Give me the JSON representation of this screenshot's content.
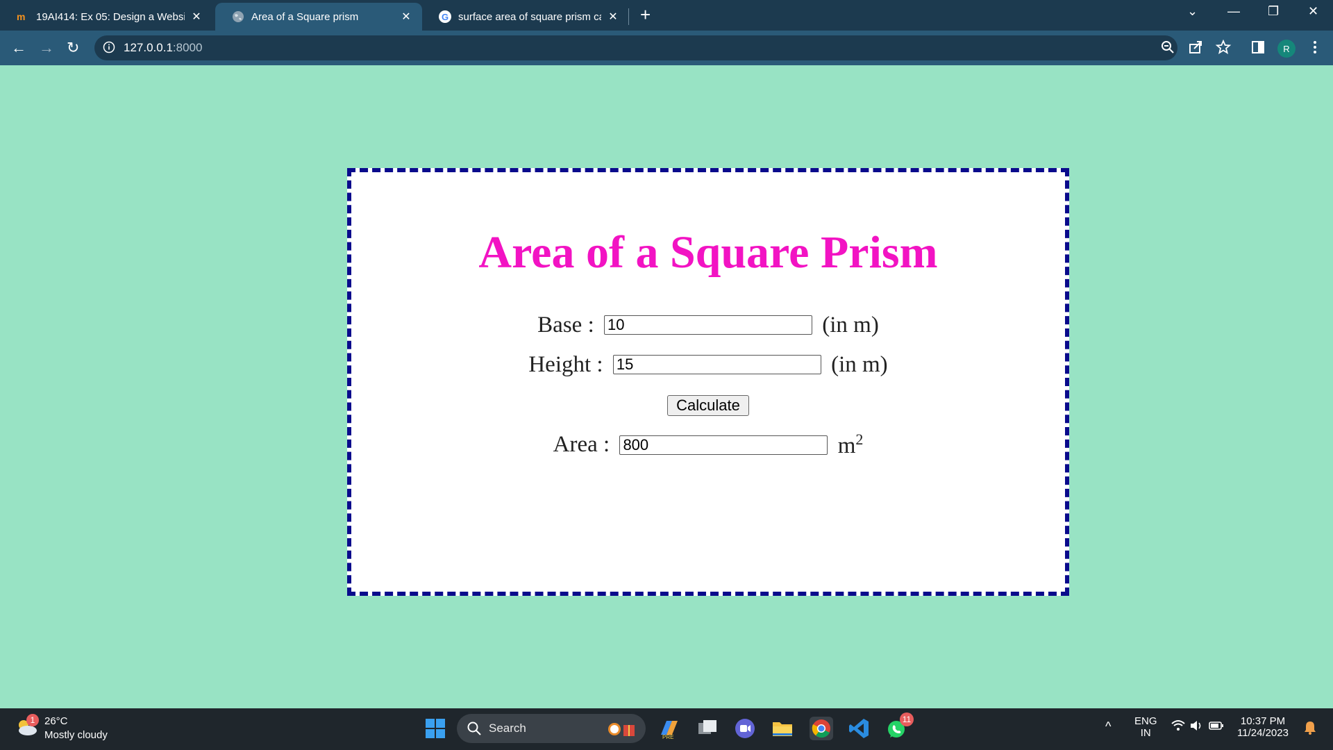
{
  "browser": {
    "tabs": [
      {
        "title": "19AI414: Ex 05: Design a Websit",
        "favicon": "moodle-icon"
      },
      {
        "title": "Area of a Square prism",
        "favicon": "globe-icon"
      },
      {
        "title": "surface area of square prism cal",
        "favicon": "google-icon"
      }
    ],
    "new_tab_label": "+",
    "url_host": "127.0.0.1",
    "url_port": ":8000",
    "profile_initial": "R"
  },
  "page": {
    "heading": "Area of a Square Prism",
    "base_label": "Base :",
    "base_value": "10",
    "base_unit": "(in m)",
    "height_label": "Height :",
    "height_value": "15",
    "height_unit": "(in m)",
    "calculate_label": "Calculate",
    "area_label": "Area :",
    "area_value": "800",
    "area_unit": "m",
    "area_unit_exp": "2",
    "colors": {
      "background": "#98e3c4",
      "heading": "#f213c3",
      "border": "#0a0b8c"
    }
  },
  "taskbar": {
    "weather_temp": "26°C",
    "weather_desc": "Mostly cloudy",
    "weather_badge": "1",
    "search_placeholder": "Search",
    "whatsapp_badge": "11",
    "lang_top": "ENG",
    "lang_bottom": "IN",
    "time": "10:37 PM",
    "date": "11/24/2023"
  }
}
